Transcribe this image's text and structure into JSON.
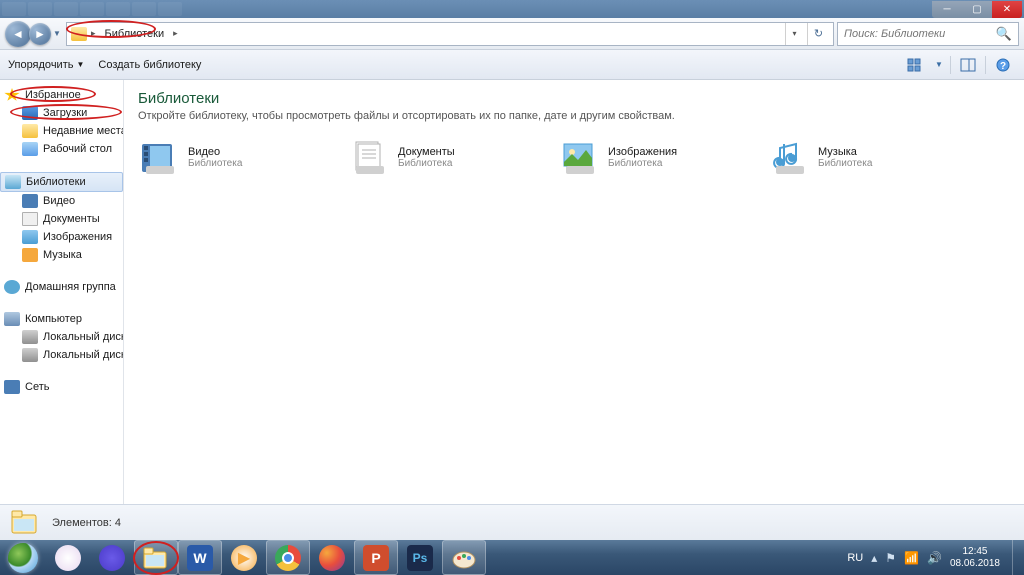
{
  "titlebar": {},
  "address": {
    "crumb": "Библиотеки"
  },
  "search": {
    "placeholder": "Поиск: Библиотеки"
  },
  "toolbar": {
    "organize": "Упорядочить",
    "newlib": "Создать библиотеку"
  },
  "sidebar": {
    "favorites": {
      "header": "Избранное",
      "downloads": "Загрузки",
      "recent": "Недавние места",
      "desktop": "Рабочий стол"
    },
    "libraries": {
      "header": "Библиотеки",
      "video": "Видео",
      "docs": "Документы",
      "images": "Изображения",
      "music": "Музыка"
    },
    "homegroup": "Домашняя группа",
    "computer": {
      "header": "Компьютер",
      "diskC": "Локальный диск (C:",
      "diskD": "Локальный диск (D:"
    },
    "network": "Сеть"
  },
  "content": {
    "title": "Библиотеки",
    "subtitle": "Откройте библиотеку, чтобы просмотреть файлы и отсортировать их по папке, дате и другим свойствам.",
    "items": [
      {
        "name": "Видео",
        "type": "Библиотека"
      },
      {
        "name": "Документы",
        "type": "Библиотека"
      },
      {
        "name": "Изображения",
        "type": "Библиотека"
      },
      {
        "name": "Музыка",
        "type": "Библиотека"
      }
    ]
  },
  "status": {
    "text": "Элементов: 4"
  },
  "taskbar": {
    "lang": "RU",
    "time": "12:45",
    "date": "08.06.2018"
  }
}
